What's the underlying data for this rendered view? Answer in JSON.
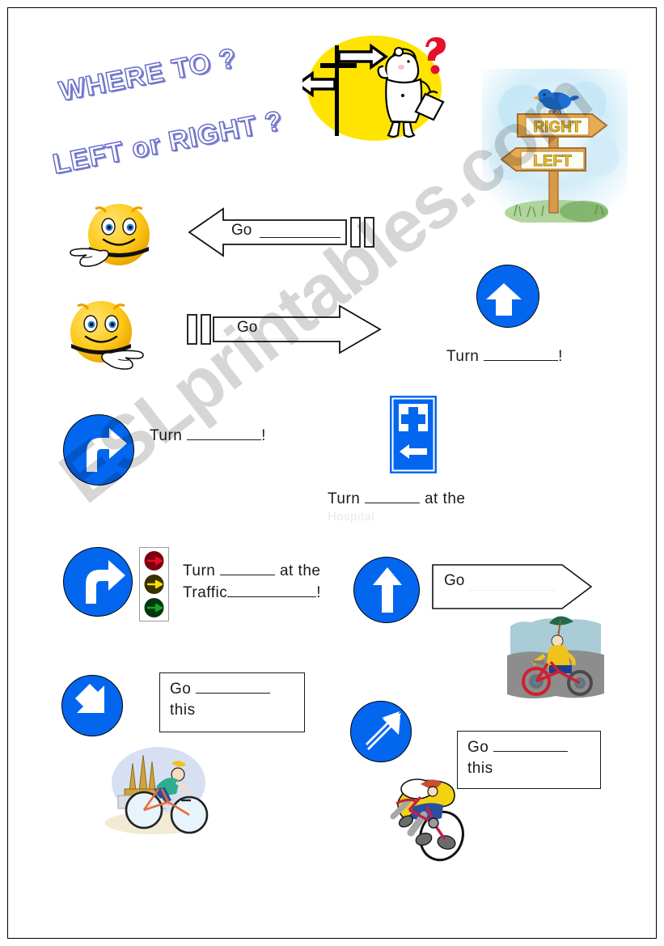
{
  "page": {
    "title_line_1": "WHERE TO ?",
    "title_line_2": "LEFT or RIGHT ?",
    "watermark": "ESLprintables.com"
  },
  "signpost": {
    "sign_upper_label": "RIGHT",
    "sign_lower_label": "LEFT"
  },
  "rows": {
    "row1": {
      "arrow_label": "Go",
      "arrow_direction": "left"
    },
    "row2": {
      "arrow_label": "Go",
      "arrow_direction": "right"
    },
    "turn_left": {
      "text_before": "Turn",
      "blank": "_________",
      "text_after": "!"
    },
    "turn_right": {
      "text_before": "Turn",
      "blank": "_________",
      "text_after": "!"
    },
    "hospital": {
      "line1_before": "Turn",
      "line1_blank": "______",
      "line1_after": "at the",
      "line2_ghost": "Hospital"
    },
    "traffic": {
      "line1_before": "Turn",
      "line1_blank": "______",
      "line1_after": "at the",
      "line2_before": "Traffic",
      "line2_blank": "__________",
      "line2_after": "!"
    },
    "straight": {
      "arrow_label": "Go"
    },
    "box_down_right": {
      "line1_before": "Go",
      "line1_blank": "_________",
      "line2": "this"
    },
    "box_up_right": {
      "line1_before": "Go",
      "line1_blank": "_________",
      "line2": "this"
    }
  },
  "colors": {
    "sign_blue": "#0266ef",
    "title_outline": "#6a6fc8",
    "ellipse_yellow": "#ffe400",
    "smiley_yellow": "#ffd219",
    "question_red": "#e3112a",
    "traffic_red": "#c00010",
    "traffic_yellow": "#f5e000",
    "traffic_green": "#0a7c20"
  }
}
